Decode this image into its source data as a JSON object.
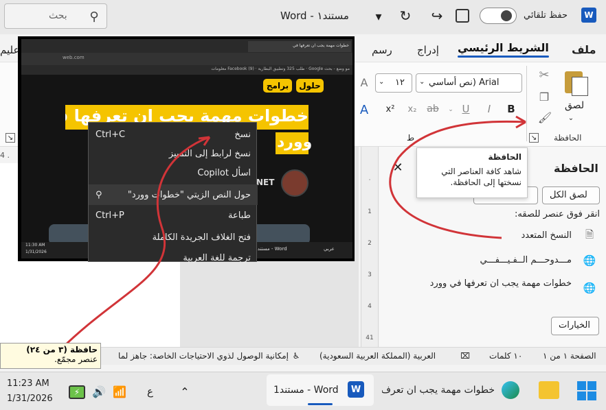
{
  "titlebar": {
    "search_placeholder": "بحث",
    "doc_title": "مستند١ - Word",
    "autosave_label": "حفظ تلقائي"
  },
  "tabs": [
    {
      "label": "ملف"
    },
    {
      "label": "الشريط الرئيسي"
    },
    {
      "label": "إدراج"
    },
    {
      "label": "رسم"
    },
    {
      "label": "عليم"
    }
  ],
  "ribbon": {
    "paste_label": "لصق",
    "clipboard_group": "الحافظة",
    "font_name": "Arial (نص أساسي",
    "font_size": "١٢",
    "font_group_partial": "ط"
  },
  "ruler_left": "4 .",
  "screenshot": {
    "browser_tabs": [
      "خطوات مهمة يجب ان تعرفها في",
      "مو وضع - بحث Google",
      "طلب 325 وتطبيق البطارية",
      "Facebook (9) معلومات"
    ],
    "url": "web.com",
    "nav_btn_programs": "برامج",
    "nav_btn_solutions": "حلول",
    "article_title_line1": "خطوات مهمة يجب ان تعرفها في",
    "article_title_line2": "وورد",
    "site_tail": "NET",
    "taskbar_time": "11:30 AM",
    "taskbar_date": "1/31/2026",
    "taskbar_app": "مستند١ - Word",
    "taskbar_weather": "عربي"
  },
  "context_menu": [
    {
      "label": "نسخ",
      "shortcut": "Ctrl+C"
    },
    {
      "label": "نسخ لرابط إلى التمييز",
      "shortcut": ""
    },
    {
      "label": "اسأل Copilot",
      "shortcut": ""
    },
    {
      "label": "حول النص الزيتي \"خطوات وورد\"",
      "shortcut": ""
    },
    {
      "label": "طباعة",
      "shortcut": "Ctrl+P"
    },
    {
      "label": "فتح الغلاف الجريدة الكاملة",
      "shortcut": ""
    },
    {
      "label": "ترجمة للغة العربية",
      "shortcut": ""
    }
  ],
  "tooltip": {
    "title": "الحافظة",
    "body": "شاهد كافة العناصر التي نسختها إلى الحافظة."
  },
  "pane": {
    "title": "الحافظة",
    "paste_all": "لصق الكل",
    "clear_all": "...",
    "instruction": "انقر فوق عنصر للصقه:",
    "items": [
      "النسخ المتعدد",
      "مـــدوحـــم الــفـيـــفـــي",
      "خطوات مهمة يجب ان تعرفها في وورد"
    ],
    "options": "الخيارات"
  },
  "clipboard_tip": {
    "line1": "حافظة (٣ من ٢٤)",
    "line2": "عنصر مجمّع."
  },
  "statusbar": {
    "page": "الصفحة ١ من ١",
    "words": "١٠ كلمات",
    "language": "العربية (المملكة العربية السعودية)",
    "accessibility": "إمكانية الوصول لذوي الاحتياجات الخاصة: جاهز لما"
  },
  "taskbar": {
    "time": "11:23 AM",
    "date": "1/31/2026",
    "lang": "ع",
    "word_label": "مستند1 - Word",
    "edge_label": "خطوات مهمة يجب ان تعرف"
  },
  "colors": {
    "accent": "#d13438",
    "article_yellow": "#f5c400",
    "word_blue": "#185abd"
  }
}
